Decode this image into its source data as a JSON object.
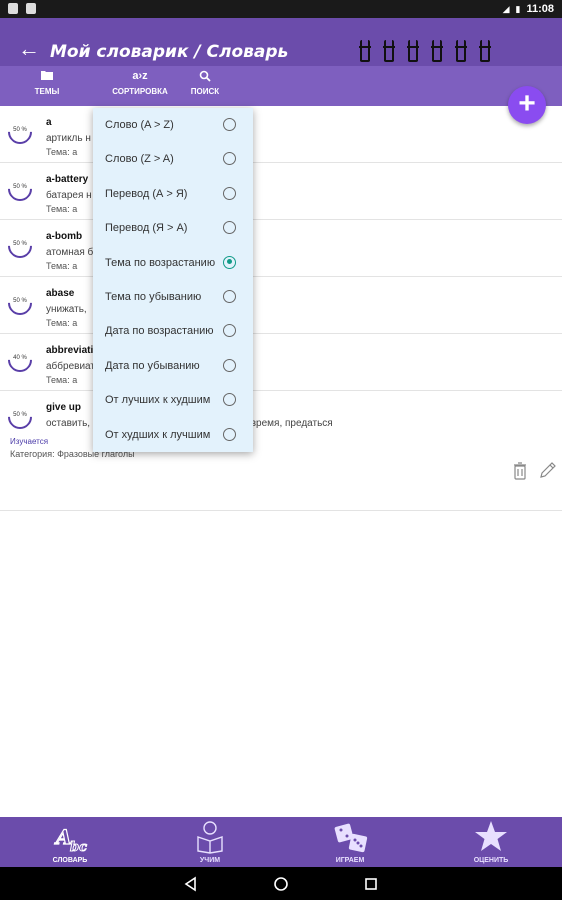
{
  "status_bar": {
    "time": "11:08"
  },
  "header": {
    "title": "Мой словарик / Словарь"
  },
  "toolbar": {
    "themes_label": "ТЕМЫ",
    "sort_label": "СОРТИРОВКА",
    "sort_icon_text": "a›z",
    "search_label": "ПОИСК"
  },
  "fab": {
    "label": "+"
  },
  "words": [
    {
      "progress": "50 %",
      "word": "a",
      "translation": "артикль н",
      "theme": "Тема:   а"
    },
    {
      "progress": "50 %",
      "word": "a-battery",
      "translation": "батарея н",
      "theme": "Тема:   а"
    },
    {
      "progress": "50 %",
      "word": "a-bomb",
      "translation": "атомная б",
      "theme": "Тема:   а"
    },
    {
      "progress": "50 %",
      "word": "abase",
      "translation": "унижать, ",
      "theme": "Тема:   а"
    },
    {
      "progress": "40 %",
      "word": "abbreviati",
      "translation": "аббревиат",
      "theme": "Тема:   а"
    },
    {
      "progress": "50 %",
      "word": "give up",
      "translation": "оставить,                                            аться, сдать, уступить, посвятить время, предаться",
      "theme": "Тема:   а",
      "status": "Изучается",
      "category": "Категория:    Фразовые глаголы"
    }
  ],
  "sort_menu": {
    "options": [
      {
        "label": "Слово (A > Z)",
        "selected": false
      },
      {
        "label": "Слово (Z > A)",
        "selected": false
      },
      {
        "label": "Перевод (А > Я)",
        "selected": false
      },
      {
        "label": "Перевод (Я > А)",
        "selected": false
      },
      {
        "label": "Тема по возрастанию",
        "selected": true
      },
      {
        "label": "Тема по убыванию",
        "selected": false
      },
      {
        "label": "Дата по возрастанию",
        "selected": false
      },
      {
        "label": "Дата по убыванию",
        "selected": false
      },
      {
        "label": "От лучших к худшим",
        "selected": false
      },
      {
        "label": "От худших к лучшим",
        "selected": false
      }
    ]
  },
  "bottom_nav": {
    "dictionary": "СЛОВАРЬ",
    "learn": "УЧИМ",
    "play": "ИГРАЕМ",
    "rate": "ОЦЕНИТЬ"
  },
  "colors": {
    "header": "#6b4cab",
    "toolbar": "#7e5fbf",
    "fab": "#8a4cf0",
    "radio_selected": "#119b88",
    "menu_bg": "#e3f2fc"
  }
}
